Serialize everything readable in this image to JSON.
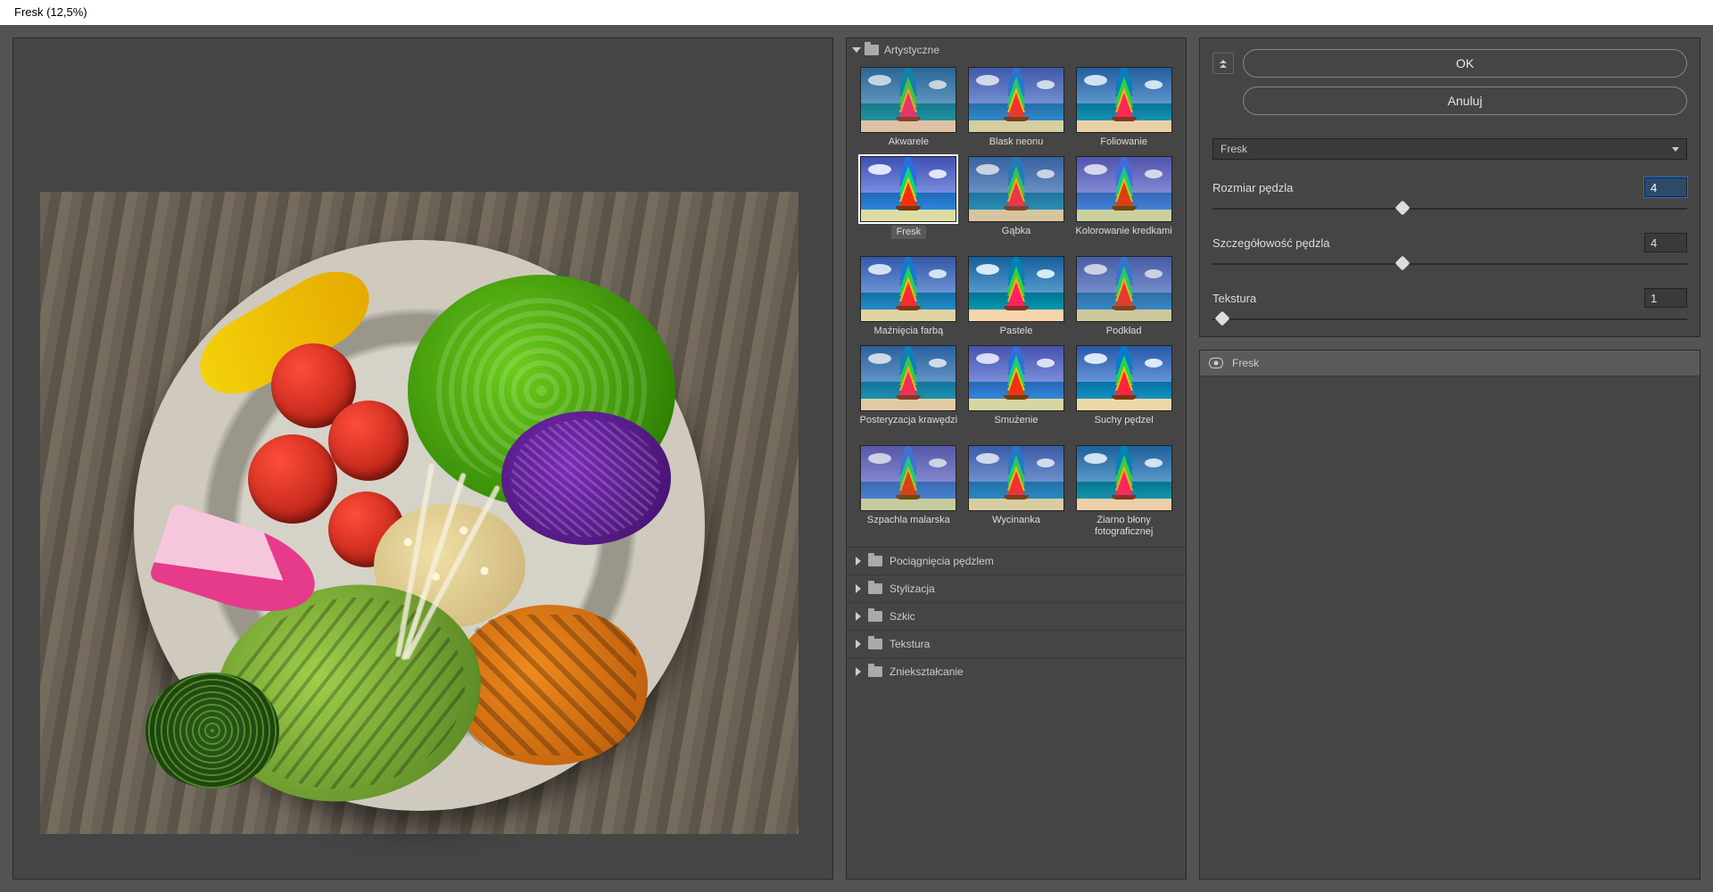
{
  "window": {
    "title": "Fresk (12,5%)"
  },
  "buttons": {
    "ok": "OK",
    "cancel": "Anuluj"
  },
  "filter_select": {
    "value": "Fresk"
  },
  "params": [
    {
      "label": "Rozmiar pędzla",
      "value": "4",
      "pos": 40,
      "focused": true
    },
    {
      "label": "Szczegółowość pędzla",
      "value": "4",
      "pos": 40,
      "focused": false
    },
    {
      "label": "Tekstura",
      "value": "1",
      "pos": 2,
      "focused": false
    }
  ],
  "categories": {
    "open": {
      "name": "Artystyczne"
    },
    "closed": [
      "Pociągnięcia pędzlem",
      "Stylizacja",
      "Szkic",
      "Tekstura",
      "Zniekształcanie"
    ]
  },
  "thumbs": [
    {
      "label": "Akwarele",
      "two": false
    },
    {
      "label": "Blask neonu",
      "two": false
    },
    {
      "label": "Foliowanie",
      "two": false
    },
    {
      "label": "Fresk",
      "two": false,
      "selected": true
    },
    {
      "label": "Gąbka",
      "two": false
    },
    {
      "label": "Kolorowanie kredkami",
      "two": true
    },
    {
      "label": "Maźnięcia farbą",
      "two": false
    },
    {
      "label": "Pastele",
      "two": false
    },
    {
      "label": "Podkład",
      "two": false
    },
    {
      "label": "Posteryzacja krawędzi",
      "two": true
    },
    {
      "label": "Smużenie",
      "two": false
    },
    {
      "label": "Suchy pędzel",
      "two": false
    },
    {
      "label": "Szpachla malarska",
      "two": true
    },
    {
      "label": "Wycinanka",
      "two": false
    },
    {
      "label": "Ziarno błony fotograficznej",
      "two": true
    }
  ],
  "layer": {
    "name": "Fresk"
  }
}
